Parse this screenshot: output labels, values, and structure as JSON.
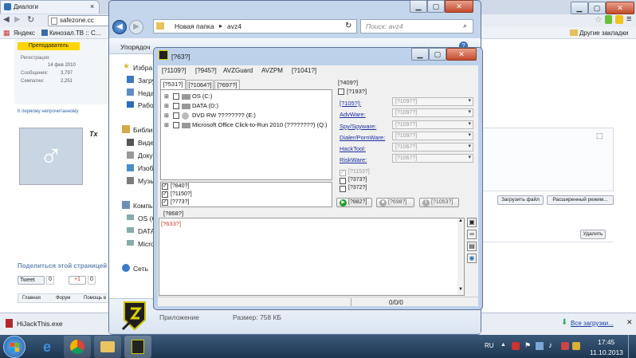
{
  "browser": {
    "tab_title": "Диалоги",
    "tab_close": "×",
    "url": "safezone.cc",
    "bm_yandex": "Яндекс",
    "bm_kinozal": "Кинозал.ТВ :: С...",
    "bm_other": "Другие закладки"
  },
  "forum": {
    "badge": "Преподаватель",
    "reg_label": "Регистрация:",
    "reg_value": "14 фев 2010",
    "msg_label": "Сообщения:",
    "msg_value": "3,797",
    "sym_label": "Симпатии:",
    "sym_value": "2,251",
    "to_first_unread": "К первому непрочитанному",
    "share_text": "Поделиться этой страницей",
    "tweet": "Tweet",
    "tweet_count": "0",
    "gplus": "+1",
    "gplus_count": "0",
    "bc_home": "Главная",
    "bc_forum": "Форум",
    "bc_help": "Помощь в",
    "upload_btn": "Загрузить файл",
    "adv_mode_btn": "Расширенный режим...",
    "delete_btn": "Удалить",
    "font_btn": "Tx"
  },
  "explorer": {
    "path_root": "Новая папка",
    "path_sep": "▸",
    "path_folder": "avz4",
    "search_placeholder": "Поиск: avz4",
    "organize": "Упорядоч",
    "nav_favorites": "Избра",
    "nav_downloads": "Загру",
    "nav_recent": "Неда",
    "nav_desktop": "Рабо",
    "nav_libraries": "Библи",
    "nav_video": "Виде",
    "nav_docs": "Доку",
    "nav_images": "Изоб",
    "nav_music": "Музь",
    "nav_computer": "Компь",
    "nav_os": "OS (C",
    "nav_data": "DATA",
    "nav_micro": "Micro",
    "nav_network": "Сеть",
    "status_app": "Приложение",
    "status_size": "Размер: 758 КБ"
  },
  "avz": {
    "title": "[?63?]",
    "menu": [
      "[?1109?]",
      "[?945?]",
      "AVZGuard",
      "AVZPM",
      "[?1041?]"
    ],
    "tabs": [
      "[?531?]",
      "[?1064?]",
      "[?697?]"
    ],
    "tree": [
      "OS (C:)",
      "DATA (D:)",
      "DVD RW ???????? (E:)",
      "Microsoft Office Click-to-Run 2010 (????????) (Q:)"
    ],
    "opts": [
      "[?840?]",
      "[?1150?]",
      "[?773?]"
    ],
    "group_label": "[?868?]",
    "right_header": "[?409?]",
    "right_cb": "[?193?]",
    "types": [
      {
        "label": "[?105?]:",
        "value": "[?1097?]"
      },
      {
        "label": "AdvWare:",
        "value": "[?1097?]"
      },
      {
        "label": "Spy/Spyware:",
        "value": "[?1097?]"
      },
      {
        "label": "Dialer/PornWare:",
        "value": "[?1097?]"
      },
      {
        "label": "HackTool:",
        "value": "[?1067?]"
      },
      {
        "label": "RiskWare:",
        "value": "[?1067?]"
      }
    ],
    "extra": [
      "[?1153?]",
      "[?373?]",
      "[?372?]"
    ],
    "btn_start": "[?882?]",
    "btn_stop": "[?698?]",
    "btn_pause": "[?1053?]",
    "log_first": "[?633?]",
    "counter": "0/0/0"
  },
  "downloads": {
    "file": "HiJackThis.exe",
    "all": "Все загрузки..."
  },
  "taskbar": {
    "lang": "RU",
    "time": "17:45",
    "date": "11.10.2013"
  }
}
